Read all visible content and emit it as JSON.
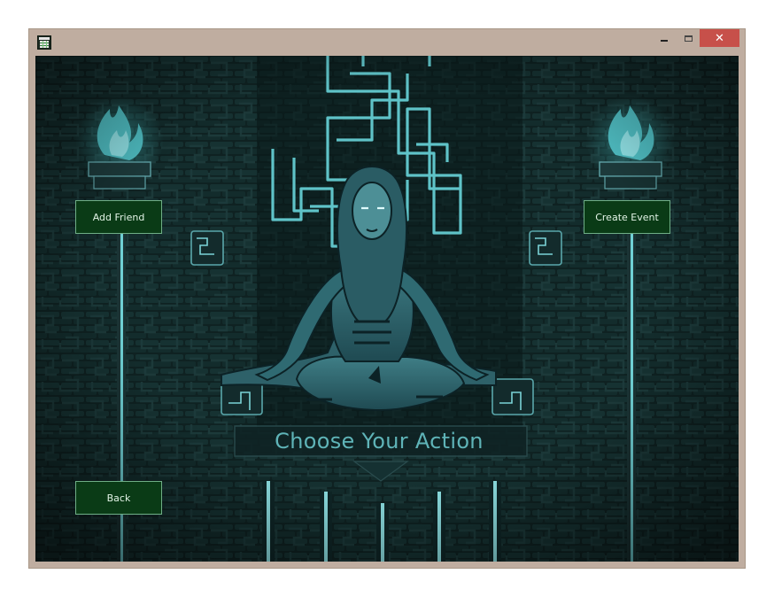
{
  "window": {
    "close_glyph": "✕",
    "icon": "spreadsheet-app-icon"
  },
  "screen": {
    "headline": "Choose Your Action",
    "buttons": {
      "add_friend": "Add Friend",
      "create_event": "Create Event",
      "back": "Back"
    }
  },
  "colors": {
    "titlebar": "#bfada0",
    "close": "#c7504a",
    "scene_bg": "#0c1a1b",
    "accent_cyan": "#5fc3c8",
    "button_bg": "#0a3b16",
    "button_border": "#6fae86",
    "headline": "#5fb4b8"
  }
}
